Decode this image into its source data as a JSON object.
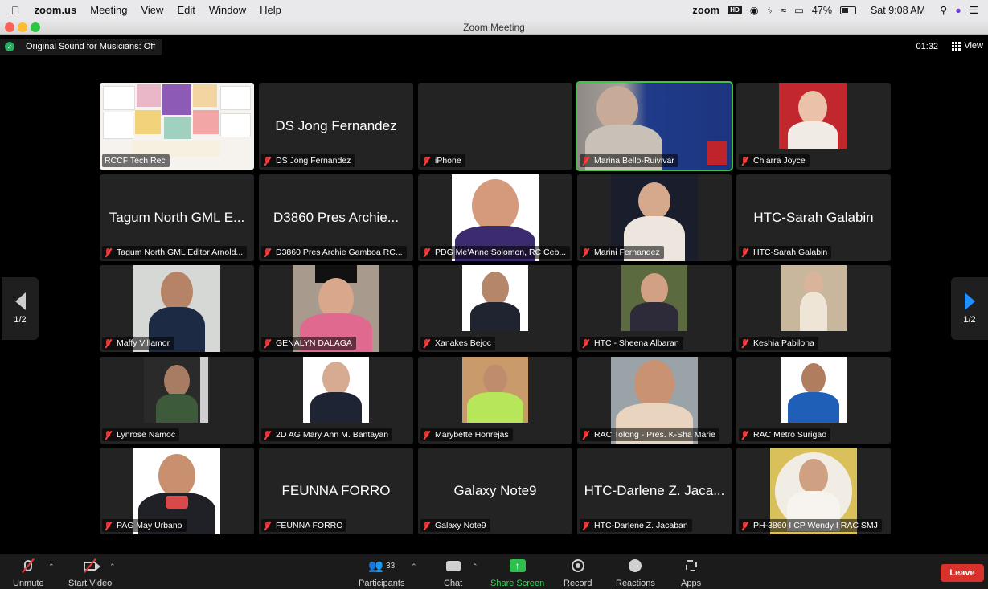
{
  "menubar": {
    "app": "zoom.us",
    "menus": [
      "Meeting",
      "View",
      "Edit",
      "Window",
      "Help"
    ],
    "brand": "zoom",
    "hd": "HD",
    "battery": "47%",
    "clock": "Sat 9:08 AM"
  },
  "window": {
    "title": "Zoom Meeting"
  },
  "status": {
    "sound": "Original Sound for Musicians: Off",
    "timer": "01:32",
    "view_label": "View",
    "page": "1/2"
  },
  "tiles": [
    {
      "label": "RCCF Tech Rec",
      "kind": "poster"
    },
    {
      "label": "DS Jong Fernandez",
      "display_name": "DS Jong Fernandez",
      "kind": "name"
    },
    {
      "label": "iPhone",
      "kind": "blank"
    },
    {
      "label": "Marina Bello-Ruivivar",
      "kind": "video",
      "active": true
    },
    {
      "label": "Chiarra Joyce",
      "kind": "photo"
    },
    {
      "label": "Tagum North GML Editor Arnold...",
      "display_name": "Tagum North GML E...",
      "kind": "name"
    },
    {
      "label": "D3860 Pres Archie Gamboa RC...",
      "display_name": "D3860 Pres Archie...",
      "kind": "name"
    },
    {
      "label": "PDG Me'Anne Solomon, RC Ceb...",
      "kind": "photo"
    },
    {
      "label": "Marini Fernandez",
      "kind": "photo"
    },
    {
      "label": "HTC-Sarah Galabin",
      "display_name": "HTC-Sarah Galabin",
      "kind": "name"
    },
    {
      "label": "Maffy Villamor",
      "kind": "photo"
    },
    {
      "label": "GENALYN DALAGA",
      "kind": "photo"
    },
    {
      "label": "Xanakes Bejoc",
      "kind": "photo"
    },
    {
      "label": "HTC - Sheena Albaran",
      "kind": "photo"
    },
    {
      "label": "Keshia Pabilona",
      "kind": "photo"
    },
    {
      "label": "Lynrose Namoc",
      "kind": "photo"
    },
    {
      "label": "2D AG Mary Ann M. Bantayan",
      "kind": "photo"
    },
    {
      "label": "Marybette Honrejas",
      "kind": "photo"
    },
    {
      "label": "RAC Tolong -  Pres. K-Sha Marie",
      "kind": "photo"
    },
    {
      "label": "RAC Metro Surigao",
      "kind": "photo"
    },
    {
      "label": "PAG May Urbano",
      "kind": "photo"
    },
    {
      "label": "FEUNNA FORRO",
      "display_name": "FEUNNA FORRO",
      "kind": "name"
    },
    {
      "label": "Galaxy Note9",
      "display_name": "Galaxy Note9",
      "kind": "name"
    },
    {
      "label": "HTC-Darlene Z. Jacaban",
      "display_name": "HTC-Darlene Z. Jaca...",
      "kind": "name"
    },
    {
      "label": "PH-3860 I CP Wendy I RAC SMJ",
      "kind": "photo"
    }
  ],
  "toolbar": {
    "unmute": "Unmute",
    "start_video": "Start Video",
    "participants": "Participants",
    "participant_count": "33",
    "chat": "Chat",
    "share": "Share Screen",
    "record": "Record",
    "reactions": "Reactions",
    "apps": "Apps",
    "leave": "Leave"
  },
  "colors": {
    "active_border": "#42c24b",
    "leave": "#d8322b",
    "share": "#2fbf4f"
  }
}
